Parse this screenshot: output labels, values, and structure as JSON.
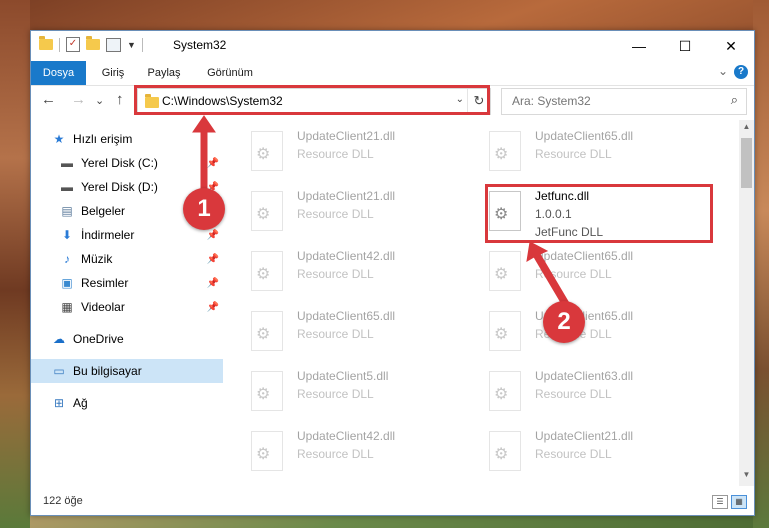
{
  "window": {
    "title": "System32",
    "minimize": "—",
    "maximize": "☐",
    "close": "✕"
  },
  "ribbon": {
    "tabs": [
      "Dosya",
      "Giriş",
      "Paylaş",
      "Görünüm"
    ],
    "expand": "⌄",
    "help": "?"
  },
  "nav": {
    "back": "←",
    "forward": "→",
    "recent": "⌄",
    "up": "↑",
    "address": "C:\\Windows\\System32",
    "address_drop": "⌄",
    "refresh": "↻",
    "search_placeholder": "Ara: System32",
    "search_icon": "⌕"
  },
  "sidebar": {
    "items": [
      {
        "label": "Hızlı erişim",
        "icon": "star-icon",
        "glyph": "★",
        "color": "#2a7bd6",
        "pinned": false
      },
      {
        "label": "Yerel Disk (C:)",
        "icon": "drive-icon",
        "glyph": "▬",
        "color": "#555",
        "pinned": true
      },
      {
        "label": "Yerel Disk (D:)",
        "icon": "drive-icon",
        "glyph": "▬",
        "color": "#555",
        "pinned": true
      },
      {
        "label": "Belgeler",
        "icon": "document-icon",
        "glyph": "▤",
        "color": "#5a7a9a",
        "pinned": true
      },
      {
        "label": "İndirmeler",
        "icon": "download-icon",
        "glyph": "⬇",
        "color": "#2a7bd6",
        "pinned": true
      },
      {
        "label": "Müzik",
        "icon": "music-icon",
        "glyph": "♪",
        "color": "#2a7bd6",
        "pinned": true
      },
      {
        "label": "Resimler",
        "icon": "pictures-icon",
        "glyph": "▣",
        "color": "#3a8ad0",
        "pinned": true
      },
      {
        "label": "Videolar",
        "icon": "video-icon",
        "glyph": "▦",
        "color": "#444",
        "pinned": true
      },
      {
        "label": "OneDrive",
        "icon": "onedrive-icon",
        "glyph": "☁",
        "color": "#1a6fc9",
        "pinned": false
      },
      {
        "label": "Bu bilgisayar",
        "icon": "computer-icon",
        "glyph": "▭",
        "color": "#3a7bc0",
        "pinned": false
      },
      {
        "label": "Ağ",
        "icon": "network-icon",
        "glyph": "⊞",
        "color": "#3a7bc0",
        "pinned": false
      }
    ],
    "pin_glyph": "📌"
  },
  "files": [
    {
      "name": "UpdateClient21.dll",
      "line2": "Resource DLL",
      "line3": ""
    },
    {
      "name": "UpdateClient65.dll",
      "line2": "Resource DLL",
      "line3": ""
    },
    {
      "name": "UpdateClient21.dll",
      "line2": "Resource DLL",
      "line3": ""
    },
    {
      "name": "Jetfunc.dll",
      "line2": "1.0.0.1",
      "line3": "JetFunc DLL"
    },
    {
      "name": "UpdateClient42.dll",
      "line2": "Resource DLL",
      "line3": ""
    },
    {
      "name": "UpdateClient65.dll",
      "line2": "Resource DLL",
      "line3": ""
    },
    {
      "name": "UpdateClient65.dll",
      "line2": "Resource DLL",
      "line3": ""
    },
    {
      "name": "UpdateClient65.dll",
      "line2": "Resource DLL",
      "line3": ""
    },
    {
      "name": "UpdateClient5.dll",
      "line2": "Resource DLL",
      "line3": ""
    },
    {
      "name": "UpdateClient63.dll",
      "line2": "Resource DLL",
      "line3": ""
    },
    {
      "name": "UpdateClient42.dll",
      "line2": "Resource DLL",
      "line3": ""
    },
    {
      "name": "UpdateClient21.dll",
      "line2": "Resource DLL",
      "line3": ""
    }
  ],
  "status": {
    "count": "122 öğe"
  },
  "annotations": {
    "badge1": "1",
    "badge2": "2",
    "color": "#d9383c"
  }
}
